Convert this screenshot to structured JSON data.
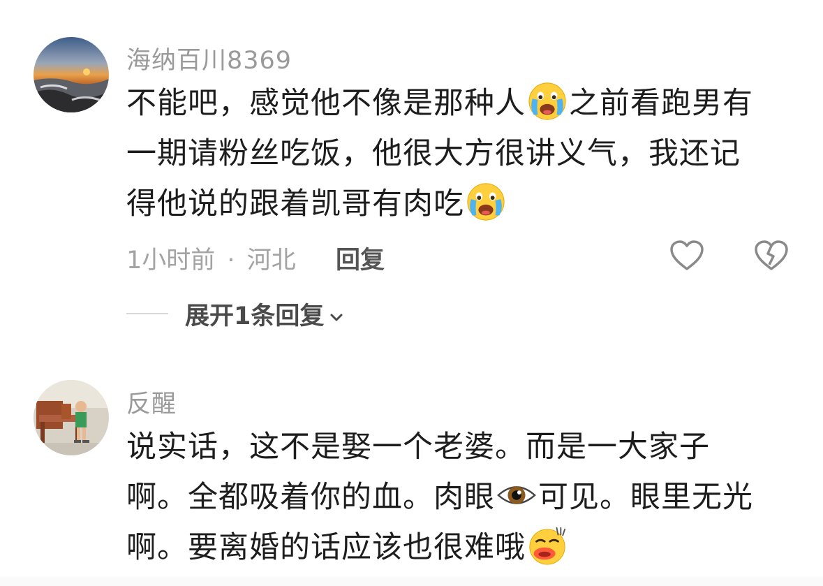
{
  "comments": [
    {
      "username": "海纳百川8369",
      "lines": [
        {
          "text1": "不能吧，感觉他不像是那种人",
          "emoji": "crying-face-emoji",
          "text2": "之前看跑男有"
        },
        {
          "text1": "一期请粉丝吃饭，他很大方很讲义气，我还记"
        },
        {
          "text1": "得他说的跟着凯哥有肉吃",
          "emoji": "crying-face-emoji"
        }
      ],
      "time": "1小时前",
      "location": "河北",
      "separator": "·",
      "reply_label": "回复",
      "expand_label": "展开1条回复"
    },
    {
      "username": "反醒",
      "lines": [
        {
          "text1": "说实话，这不是娶一个老婆。而是一大家子"
        },
        {
          "text1": "啊。全都吸着你的血。肉眼",
          "emoji": "eye-emoji",
          "text2": "可见。眼里无光"
        },
        {
          "text1": "啊。要离婚的话应该也很难哦",
          "emoji": "yawning-face-emoji"
        }
      ]
    }
  ],
  "colors": {
    "username": "#9a9a9a",
    "body": "#1d1d1d",
    "meta": "#a3a3a3",
    "icon_stroke": "#8a8a8a"
  }
}
